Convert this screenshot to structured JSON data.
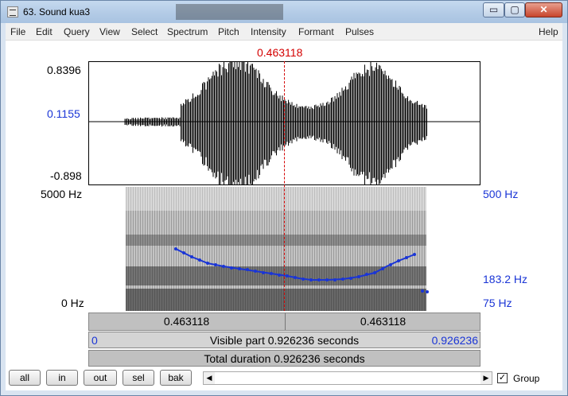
{
  "window": {
    "title": "63. Sound kua3",
    "min_glyph": "▭",
    "max_glyph": "▢",
    "close_glyph": "✕"
  },
  "menu": [
    "File",
    "Edit",
    "Query",
    "View",
    "Select",
    "Spectrum",
    "Pitch",
    "Intensity",
    "Formant",
    "Pulses"
  ],
  "help": "Help",
  "cursor_time": "0.463118",
  "waveform": {
    "y_top": "0.8396",
    "y_mid": "0.1155",
    "y_bottom": "-0.898"
  },
  "spectrogram": {
    "top_freq": "5000 Hz",
    "bottom_freq": "0 Hz",
    "pitch_top": "500 Hz",
    "pitch_mid": "183.2 Hz",
    "pitch_bottom": "75 Hz"
  },
  "time_bar": {
    "left": "0.463118",
    "right": "0.463118"
  },
  "visible": {
    "start": "0",
    "label": "Visible part 0.926236 seconds",
    "end": "0.926236"
  },
  "total": "Total duration 0.926236 seconds",
  "buttons": {
    "all": "all",
    "in": "in",
    "out": "out",
    "sel": "sel",
    "bak": "bak"
  },
  "scroll_left": "◀",
  "scroll_right": "▶",
  "group": {
    "checked": "✓",
    "label": "Group"
  }
}
